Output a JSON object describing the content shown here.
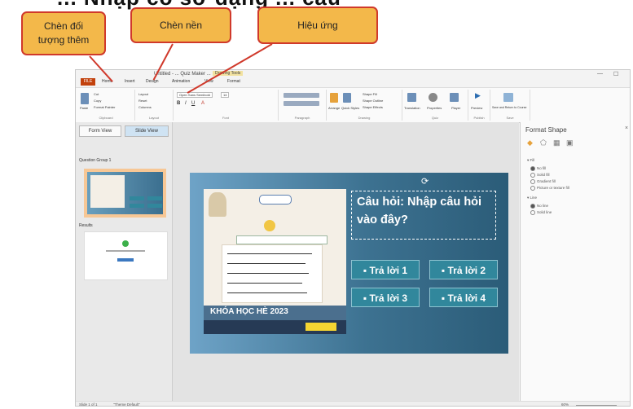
{
  "heading_fragment": "... Nhập cô sở dạng ... câu",
  "callouts": [
    "Chèn đối tượng thêm",
    "Chèn nền",
    "Hiệu ứng"
  ],
  "window": {
    "title": "Untitled - ... Quiz Maker ...",
    "context_tab": "Drawing Tools",
    "file_tab": "FILE",
    "tabs": [
      "Home",
      "Insert",
      "Design",
      "Animation",
      "View",
      "Format"
    ]
  },
  "ribbon": {
    "clipboard": {
      "items": [
        "Cut",
        "Copy",
        "Format Painter"
      ],
      "paste": "Paste",
      "label": "Clipboard"
    },
    "layout": {
      "items": [
        "Layout",
        "Reset",
        "Columns"
      ],
      "label": "Layout"
    },
    "font": {
      "family": "Open Sans Semibold",
      "size": "14",
      "label": "Font"
    },
    "paragraph": {
      "label": "Paragraph"
    },
    "drawing": {
      "items": [
        "Shape Fill",
        "Shape Outline",
        "Shape Effects"
      ],
      "arrange": "Arrange",
      "quick_styles": "Quick Styles",
      "label": "Drawing"
    },
    "quiz": {
      "items": [
        "Translation",
        "Properties",
        "Player"
      ],
      "label": "Quiz"
    },
    "publish": {
      "items": [
        "Preview"
      ],
      "label": "Publish"
    },
    "save": {
      "items": [
        "Save and Return to Course"
      ],
      "label": "Save"
    }
  },
  "left": {
    "form_view": "Form View",
    "slide_view": "Slide View",
    "question_group": "Question Group 1",
    "results": "Results"
  },
  "slide": {
    "question": "Câu hỏi: Nhập câu hỏi vào đây?",
    "answers": [
      "Trả lời 1",
      "Trả lời 2",
      "Trả lời 3",
      "Trả lời 4"
    ],
    "poster": {
      "banner": "KHÓA HỌC HÈ 2023"
    }
  },
  "format_shape": {
    "title": "Format Shape",
    "fill_header": "Fill",
    "fill_options": [
      "No fill",
      "Solid fill",
      "Gradient fill",
      "Picture or texture fill"
    ],
    "line_header": "Line",
    "line_options": [
      "No line",
      "Solid line"
    ]
  },
  "status": {
    "slide": "Slide 1 of 1",
    "theme": "\"Theme Default\"",
    "zoom": "60%"
  }
}
